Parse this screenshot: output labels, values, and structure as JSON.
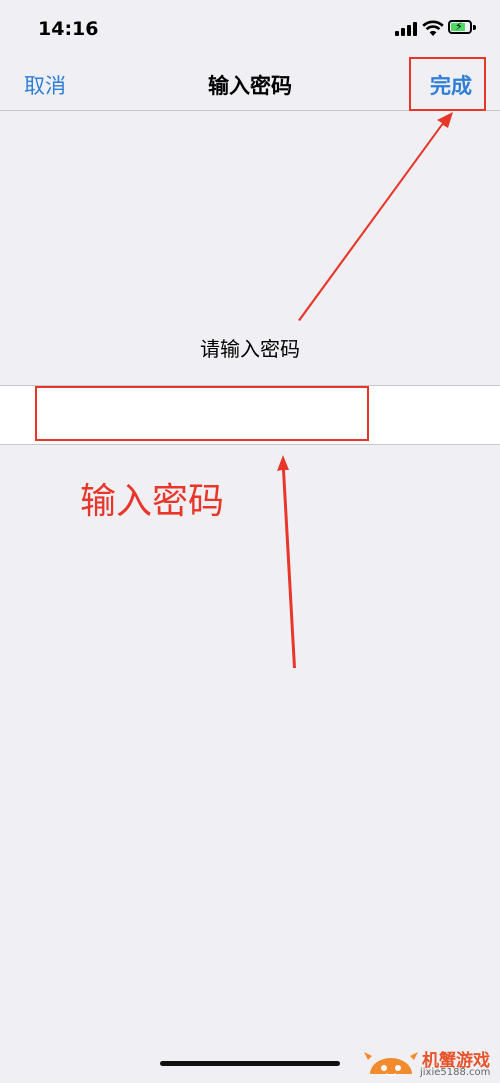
{
  "status_bar": {
    "time": "14:16"
  },
  "nav": {
    "cancel_label": "取消",
    "title": "输入密码",
    "done_label": "完成"
  },
  "form": {
    "prompt": "请输入密码",
    "password_value": ""
  },
  "annotation": {
    "text": "输入密码",
    "color": "#e8372a"
  },
  "colors": {
    "accent": "#2f7fd6",
    "background": "#efeff4",
    "annotation_red": "#e8372a"
  },
  "watermark": {
    "name": "机蟹游戏",
    "url": "jixie5188.com"
  }
}
